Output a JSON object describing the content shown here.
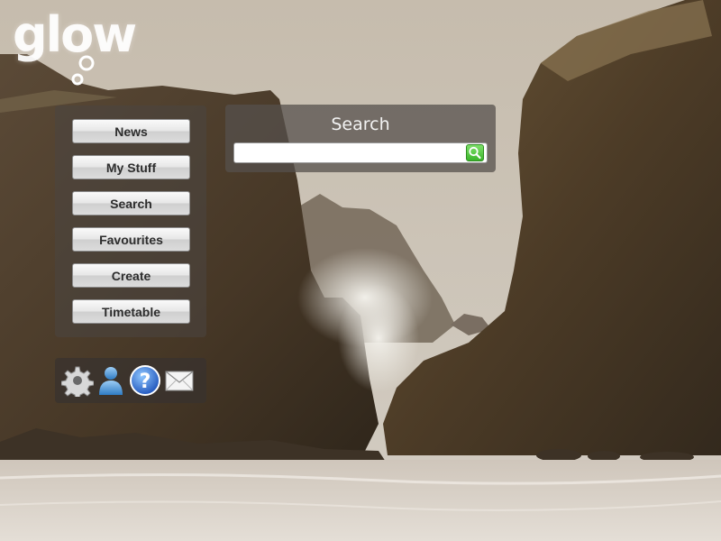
{
  "brand": {
    "logo_text": "glow"
  },
  "background": {
    "description_icon": "coastal-cliffs-photo",
    "sky_color": "#cbc2b4",
    "rock_color": "#4a3b2a",
    "sea_color": "#d7cfc6"
  },
  "nav": {
    "items": [
      {
        "label": "News"
      },
      {
        "label": "My Stuff"
      },
      {
        "label": "Search"
      },
      {
        "label": "Favourites"
      },
      {
        "label": "Create"
      },
      {
        "label": "Timetable"
      }
    ]
  },
  "tools": {
    "icons": [
      "gear-icon",
      "user-icon",
      "help-icon",
      "mail-icon"
    ]
  },
  "search": {
    "title": "Search",
    "placeholder": "",
    "value": "",
    "button_icon": "magnifier-icon",
    "button_color": "#4cc23a"
  }
}
